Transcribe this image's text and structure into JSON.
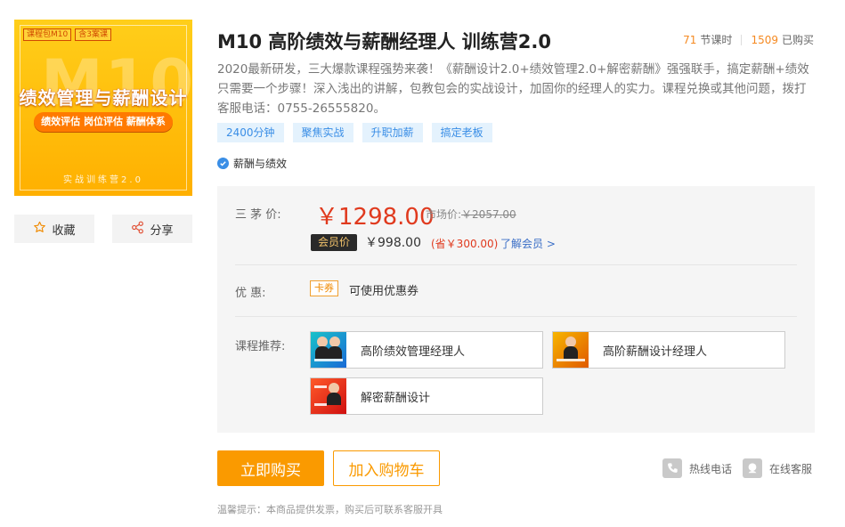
{
  "cover": {
    "tag1": "课程包M10",
    "tag2": "含3案课",
    "big_text": "M10",
    "title": "绩效管理与薪酬设计",
    "subtitle": "绩效评估  岗位评估  薪酬体系",
    "footer": "实战训练营2.0"
  },
  "sidebar": {
    "favorite_label": "收藏",
    "share_label": "分享"
  },
  "product": {
    "title": "M10 高阶绩效与薪酬经理人 训练营2.0",
    "lessons_count": "71",
    "lessons_label": "节课时",
    "buyers_count": "1509",
    "buyers_label": "已购买",
    "description": "2020最新研发，三大爆款课程强势来袭！《薪酬设计2.0+绩效管理2.0+解密薪酬》强强联手，搞定薪酬+绩效只需要一个步骤！深入浅出的讲解，包教包会的实战设计，加固你的经理人的实力。课程兑换或其他问题，拨打客服电话：0755-26555820。",
    "keywords": [
      "2400分钟",
      "聚焦实战",
      "升职加薪",
      "搞定老板"
    ],
    "category": "薪酬与绩效"
  },
  "pricing": {
    "price_label": "三 茅 价:",
    "price": "￥1298.00",
    "market_label": "市场价:",
    "market_price": "￥2057.00",
    "vip_badge": "会员价",
    "vip_price": "￥998.00",
    "vip_save": "(省￥300.00)",
    "vip_link": "了解会员 >",
    "discount_label": "优      惠:",
    "coupon_tag": "卡券",
    "coupon_text": "可使用优惠券",
    "recommend_label": "课程推荐:",
    "recommendations": [
      "高阶绩效管理经理人",
      "高阶薪酬设计经理人",
      "解密薪酬设计"
    ]
  },
  "actions": {
    "buy_label": "立即购买",
    "cart_label": "加入购物车",
    "hotline_label": "热线电话",
    "service_label": "在线客服"
  },
  "tip": "温馨提示：本商品提供发票，购买后可联系客服开具",
  "colors": {
    "accent_orange": "#fa9a00",
    "price_red": "#e03a1e",
    "tag_blue_bg": "#e4f2fd",
    "tag_blue_text": "#3a8ee6"
  }
}
